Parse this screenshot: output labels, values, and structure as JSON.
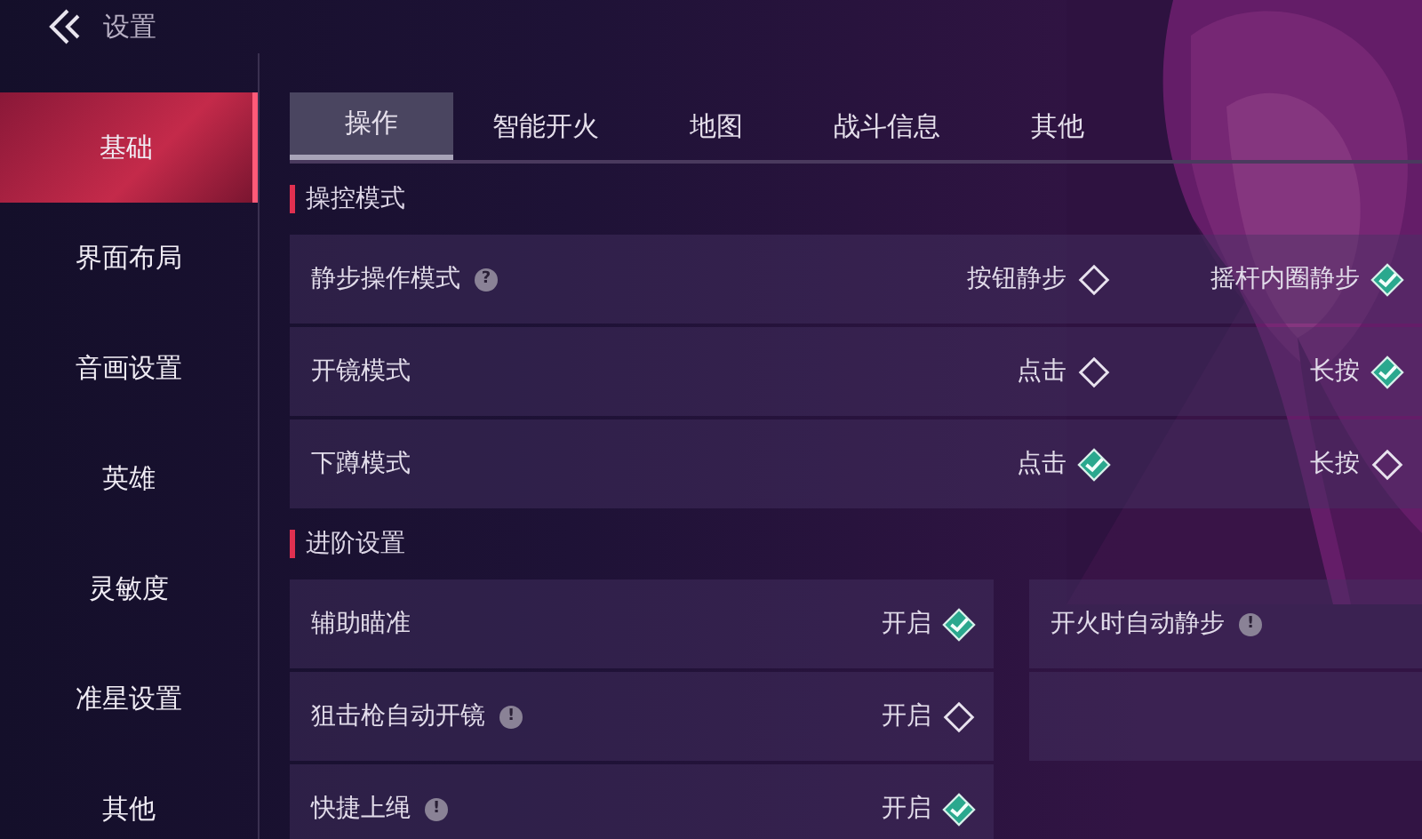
{
  "header": {
    "title": "设置"
  },
  "sidebar": {
    "items": [
      {
        "label": "基础",
        "selected": true
      },
      {
        "label": "界面布局",
        "selected": false
      },
      {
        "label": "音画设置",
        "selected": false
      },
      {
        "label": "英雄",
        "selected": false
      },
      {
        "label": "灵敏度",
        "selected": false
      },
      {
        "label": "准星设置",
        "selected": false
      },
      {
        "label": "其他",
        "selected": false
      }
    ]
  },
  "tabs": [
    {
      "label": "操作",
      "selected": true
    },
    {
      "label": "智能开火",
      "selected": false
    },
    {
      "label": "地图",
      "selected": false
    },
    {
      "label": "战斗信息",
      "selected": false
    },
    {
      "label": "其他",
      "selected": false
    }
  ],
  "sections": [
    {
      "title": "操控模式",
      "kind": "full",
      "rows": [
        {
          "kind": "setting",
          "label": "静步操作模式",
          "hint": "?",
          "options": [
            {
              "label": "按钮静步",
              "checked": false
            },
            {
              "label": "摇杆内圈静步",
              "checked": true
            }
          ]
        },
        {
          "kind": "setting",
          "label": "开镜模式",
          "options": [
            {
              "label": "点击",
              "checked": false
            },
            {
              "label": "长按",
              "checked": true
            }
          ]
        },
        {
          "kind": "setting",
          "label": "下蹲模式",
          "options": [
            {
              "label": "点击",
              "checked": true
            },
            {
              "label": "长按",
              "checked": false
            }
          ]
        }
      ]
    },
    {
      "title": "进阶设置",
      "kind": "columns",
      "rows": [
        {
          "kind": "setting",
          "label": "辅助瞄准",
          "options": [
            {
              "label": "开启",
              "checked": true
            }
          ]
        },
        {
          "kind": "setting",
          "label": "开火时自动静步",
          "hint": "!"
        },
        {
          "kind": "setting",
          "label": "狙击枪自动开镜",
          "hint": "!",
          "options": [
            {
              "label": "开启",
              "checked": false
            }
          ]
        },
        {
          "kind": "blank"
        },
        {
          "kind": "setting",
          "label": "快捷上绳",
          "hint": "!",
          "options": [
            {
              "label": "开启",
              "checked": true
            }
          ]
        }
      ]
    }
  ]
}
